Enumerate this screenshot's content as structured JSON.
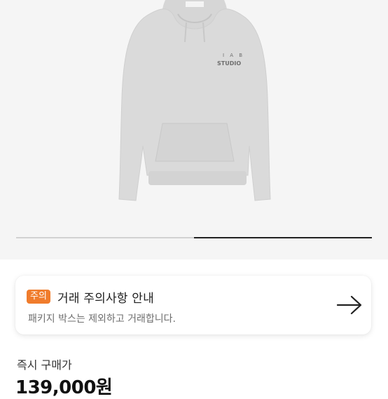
{
  "product_image": {
    "print_top": "I A B",
    "print_bottom": "STUDIO",
    "progress": 0.5
  },
  "notice": {
    "badge": "주의",
    "title": "거래 주의사항 안내",
    "subtitle": "패키지 박스는 제외하고 거래합니다.",
    "arrow_icon": "arrow-right-icon"
  },
  "price": {
    "label": "즉시 구매가",
    "value": "139,000원"
  },
  "colors": {
    "badge": "#f07c2c",
    "hoodie": "#d9d9d9",
    "background": "#f5f5f5"
  }
}
